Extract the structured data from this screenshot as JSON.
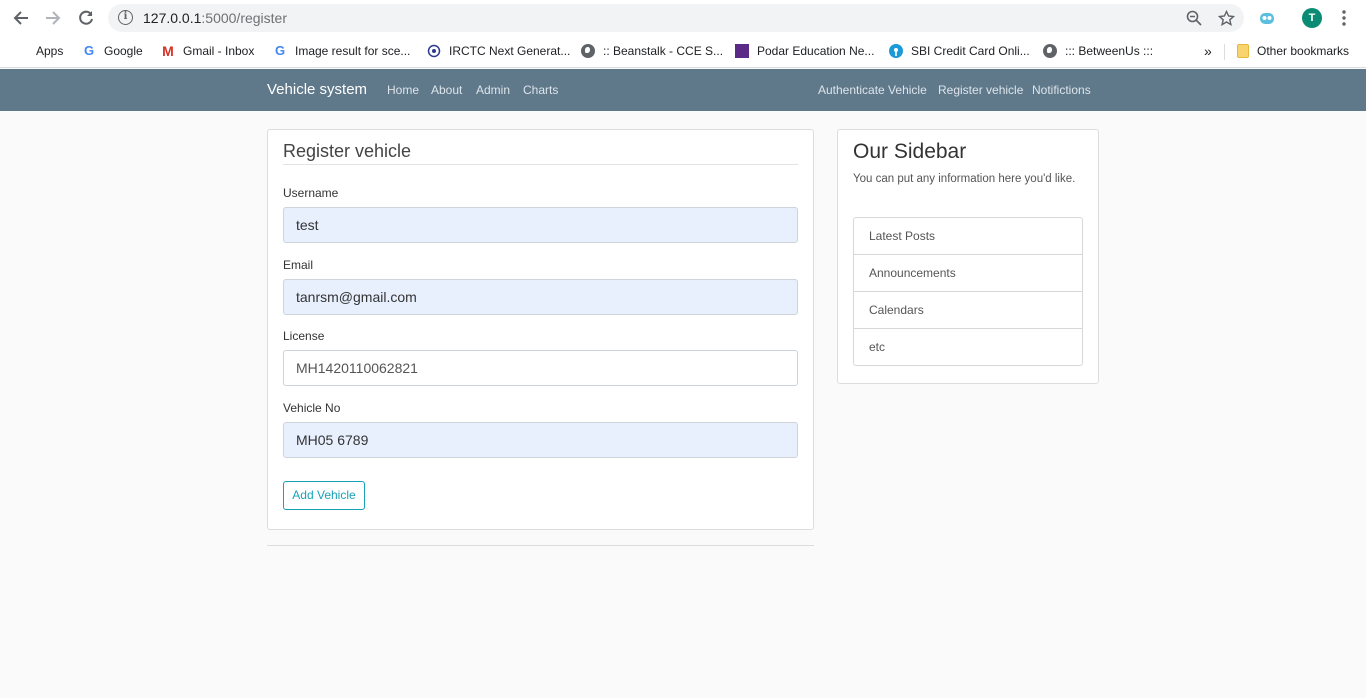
{
  "browser": {
    "url_host": "127.0.0.1",
    "url_path": ":5000/register",
    "profile_initial": "T",
    "bookmarks": [
      {
        "label": "Apps",
        "icon": "apps-grid-icon"
      },
      {
        "label": "Google",
        "icon": "google-icon"
      },
      {
        "label": "Gmail - Inbox",
        "icon": "gmail-icon"
      },
      {
        "label": "Image result for sce...",
        "icon": "google-icon"
      },
      {
        "label": "IRCTC Next Generat...",
        "icon": "irctc-icon"
      },
      {
        "label": ":: Beanstalk - CCE S...",
        "icon": "globe-icon"
      },
      {
        "label": "Podar Education Ne...",
        "icon": "podar-icon"
      },
      {
        "label": "SBI Credit Card Onli...",
        "icon": "sbi-icon"
      },
      {
        "label": "::: BetweenUs :::",
        "icon": "globe-icon"
      }
    ],
    "overflow": "»",
    "other_bookmarks": "Other bookmarks"
  },
  "navbar": {
    "brand": "Vehicle system",
    "left_links": [
      "Home",
      "About",
      "Admin",
      "Charts"
    ],
    "right_links": [
      "Authenticate Vehicle",
      "Register vehicle",
      "Notifictions"
    ],
    "background": "#5f788a"
  },
  "form": {
    "title": "Register vehicle",
    "fields": [
      {
        "label": "Username",
        "value": "test"
      },
      {
        "label": "Email",
        "value": "tanrsm@gmail.com"
      },
      {
        "label": "License",
        "value": "MH1420110062821"
      },
      {
        "label": "Vehicle No",
        "value": "MH05 6789"
      }
    ],
    "submit_label": "Add Vehicle",
    "accent": "#17a2b8"
  },
  "sidebar": {
    "title": "Our Sidebar",
    "text": "You can put any information here you'd like.",
    "items": [
      "Latest Posts",
      "Announcements",
      "Calendars",
      "etc"
    ]
  }
}
